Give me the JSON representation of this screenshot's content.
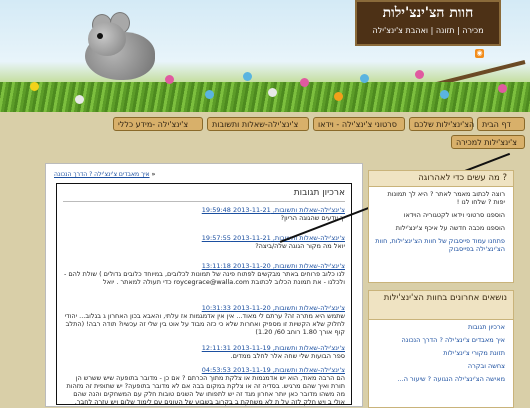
{
  "header": {
    "site_title": "חוות הצ'ינצ'ילות",
    "top_links": "מכירה | תזונה | ואהבת צ'ינצ'ילה"
  },
  "nav": {
    "row1": [
      "דף הבית",
      "הצ'ינצ'ילות שלכם",
      "סרטוני צ'ינצ'ילה - וידאו",
      "צ'ינצ'ילה-שאלות ותשובות",
      "צ'ינצ'ילה -מידע כללי"
    ],
    "row2": [
      "צ'ינצ'ילות למכירה"
    ]
  },
  "breadcrumb": {
    "link": "איך מאבדים צ'ינצ'ילה ? הדרך הנכונה",
    "separator": "»"
  },
  "archive": {
    "title": "ארכיון תגובות",
    "entries": [
      {
        "meta": "צ'ינצ'ילה-שאלות ותשובות, 2013-11-21 19:59:48",
        "text": "יך יודעים שהגוגה הריון?"
      },
      {
        "meta": "צ'ינצ'ילה-שאלות ותשובות, 2013-11-21 19:57:55",
        "text": "יואל מה מקור הגוגה שלה/ביצה?"
      },
      {
        "meta": "צ'ינצ'ילה-שאלות ותשובות, 2013-11-20 13:11:18",
        "text": "לנו כלוב פרוחים באתר מבקשים לפתוח פינה של תמונות לכלובים, במיוחד כלובים גדולים ) שולת להם - ולכלנו - את תמונת הכלוב לכתובת roycegrace@walla.com כדי תעולה למאתר . יואל"
      },
      {
        "meta": "צ'ינצ'ילה-שאלות ותשובות, 2013-11-20 10:31:33",
        "text": "שתמש היא מתרה זה? ערתם לי מאוד... אין אין אדמגמות אז עלתי, והאבא בכון האחרון ג בגלוב... יהודי לחלוק שלא הקשיות זו מספיק ואחרות שלא כי כזה מבוד על אוט בין שלי זה עכשיו? תודה רבה! (התלב קוף אורך 1.80 רוחב 60/ 1.20)"
      },
      {
        "meta": "צ'ינצ'ילה-שאלות ותשובות, 2013-11-19 12:11:31",
        "text": "ספר הבועות שלי שחה אלר לחלב ממדים."
      },
      {
        "meta": "צ'ינצ'ילה-שאלות ותשובות, 2013-11-19 04:53:53",
        "text": "הם הרבה מאוד, הוא יש אדמגמות או צלקת מתוך הכרתם ? אם כן - מדובר בתופעה שיש ששרש הן תורת ואיך שהם מרגיש. בסדיה זה או צלקת במקום בבה אם לא מדובר בתופעה? יש שתופית זה מזהות מה משהו מדובר כאן יותר אחרון מגד זה יש לתפותו של השנים טובות חלק עם המשחקים והנה שהם אולי ב ויש חלק לזה על ת לא משחקת ב בקרוב בשבוע של העונים עם לימוד שלום ויש עזרה לחבר."
      }
    ]
  },
  "sidebar": {
    "box1_title": "מה עשים כדי לאהרוגה ?",
    "box1_items": [
      "רוצה לכתוב מאמר לאתר ? היא לך תמונות יפות ? שלחו לנו !",
      "הוספנו סרטוני וידאו לקטגוריה הוידאו",
      "הוספנו מכבה חדשה על איכף צ'ינצ'ילות",
      "פתחנו עמוד פייסבוק של חוות הצ'ינצ'ילות, חוות הצ'ינצ'ילה בפייסבוק"
    ],
    "box2_title": "נושאים אחרונים בחוות הצ'ינצ'ילות",
    "box2_items": [
      "ארכיון תגובות",
      "איך מאבדים צ'ינצ'ילה ? הדרך הנכונה",
      "תזונת מקורי צ'ינצ'ילות",
      "צחשה ובקרה",
      "מאישה הצ'ינצ'ילה הנגועה ? שיעור ה..."
    ]
  },
  "colors": {
    "nav_btn": "#d8b06a",
    "title_board": "#4d3116",
    "link": "#1b4fa0",
    "page_bg": "#d9cfa8"
  }
}
